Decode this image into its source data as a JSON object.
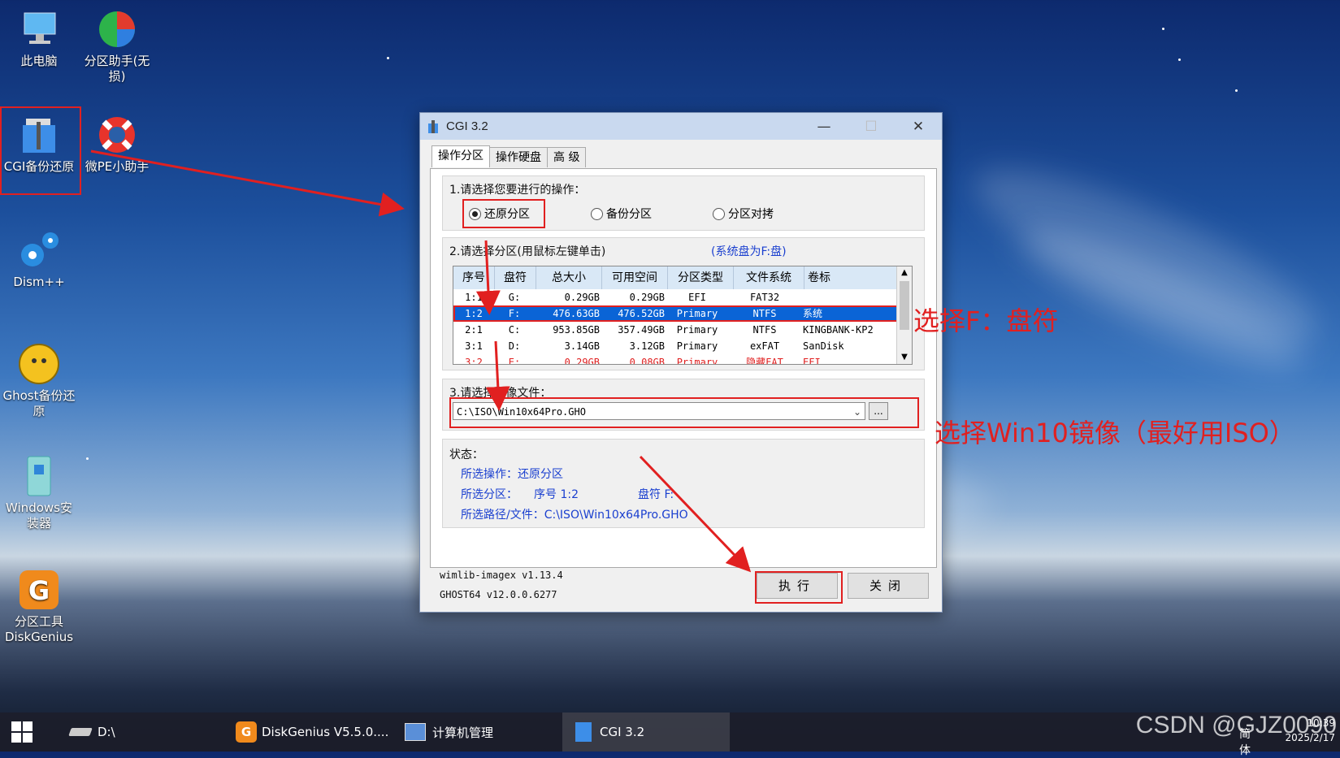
{
  "desktop": {
    "icons": [
      {
        "label": "此电脑"
      },
      {
        "label": "分区助手(无损)"
      },
      {
        "label": "CGI备份还原"
      },
      {
        "label": "微PE小助手"
      },
      {
        "label": "Dism++"
      },
      {
        "label": "Ghost备份还原"
      },
      {
        "label": "Windows安装器"
      },
      {
        "label": "分区工具DiskGenius"
      }
    ]
  },
  "window": {
    "title": "CGI 3.2",
    "tabs": [
      "操作分区",
      "操作硬盘",
      "高 级"
    ],
    "section1": {
      "title": "1.请选择您要进行的操作：",
      "options": [
        {
          "label": "还原分区",
          "checked": true
        },
        {
          "label": "备份分区",
          "checked": false
        },
        {
          "label": "分区对拷",
          "checked": false
        }
      ]
    },
    "section2": {
      "title": "2.请选择分区(用鼠标左键单击)",
      "system_note": "(系统盘为F:盘)",
      "columns": [
        "序号",
        "盘符",
        "总大小",
        "可用空间",
        "分区类型",
        "文件系统",
        "卷标"
      ],
      "rows": [
        {
          "cells": [
            "1:1",
            "G:",
            "0.29GB",
            "0.29GB",
            "EFI",
            "FAT32",
            ""
          ],
          "state": "normal"
        },
        {
          "cells": [
            "1:2",
            "F:",
            "476.63GB",
            "476.52GB",
            "Primary",
            "NTFS",
            "系统"
          ],
          "state": "selected"
        },
        {
          "cells": [
            "2:1",
            "C:",
            "953.85GB",
            "357.49GB",
            "Primary",
            "NTFS",
            "KINGBANK-KP2"
          ],
          "state": "normal"
        },
        {
          "cells": [
            "3:1",
            "D:",
            "3.14GB",
            "3.12GB",
            "Primary",
            "exFAT",
            "SanDisk"
          ],
          "state": "normal"
        },
        {
          "cells": [
            "3:2",
            "E:",
            "0.29GB",
            "0.08GB",
            "Primary",
            "隐藏FAT",
            "EFI"
          ],
          "state": "hidden"
        }
      ]
    },
    "section3": {
      "title": "3.请选择镜像文件：",
      "path": "C:\\ISO\\Win10x64Pro.GHO",
      "browse_label": "..."
    },
    "status": {
      "title": "状态：",
      "operation": "所选操作：还原分区",
      "partition_label": "所选分区：",
      "partition_index": "序号 1:2",
      "partition_drive": "盘符 F:",
      "path": "所选路径/文件：C:\\ISO\\Win10x64Pro.GHO"
    },
    "versions": [
      "wimlib-imagex v1.13.4",
      "GHOST64 v12.0.0.6277"
    ],
    "buttons": {
      "execute": "执行",
      "close": "关闭"
    }
  },
  "annotations": {
    "select_drive": "选择F：盘符",
    "select_image": "选择Win10镜像（最好用ISO）",
    "color": "#e12020"
  },
  "taskbar": {
    "items": [
      "D:\\",
      "DiskGenius V5.5.0....",
      "计算机管理",
      "CGI 3.2"
    ],
    "ime": "简体",
    "time": "10:39",
    "date": "2025/2/17"
  },
  "watermark": "CSDN @GJZ0090"
}
